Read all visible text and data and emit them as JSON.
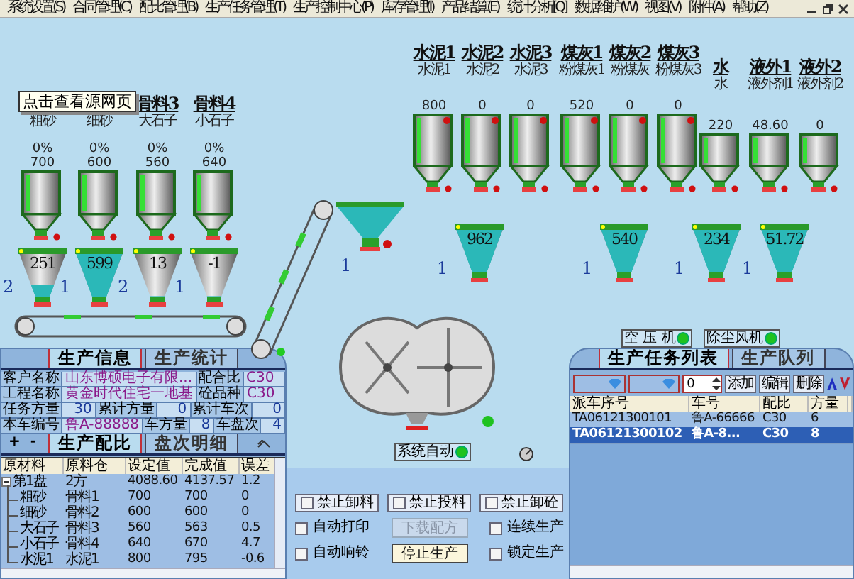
{
  "menu": [
    "系统设置(S)",
    "合同管理(C)",
    "配比管理(B)",
    "生产任务管理(T)",
    "生产控制中心(P)",
    "库存管理(I)",
    "产品结算(E)",
    "统计分析[Q]",
    "数据维护(W)",
    "视图(V)",
    "附件(A)",
    "帮助(Z)"
  ],
  "tooltip": "点击查看源网页",
  "aggregates": [
    {
      "subtitle": "粗砂",
      "percent": "0%",
      "value": "700",
      "weight": "251",
      "count": "2",
      "level": 0.25
    },
    {
      "subtitle": "细砂",
      "percent": "0%",
      "value": "600",
      "weight": "599",
      "count": "1",
      "level": 1
    },
    {
      "label": "骨料3",
      "subtitle": "大石子",
      "percent": "0%",
      "value": "560",
      "weight": "13",
      "count": "2",
      "level": 0
    },
    {
      "label": "骨料4",
      "subtitle": "小石子",
      "percent": "0%",
      "value": "640",
      "weight": "-1",
      "count": "1",
      "level": 0
    }
  ],
  "powders": [
    {
      "label": "水泥1",
      "subtitle": "水泥1",
      "value": "800"
    },
    {
      "label": "水泥2",
      "subtitle": "水泥2",
      "value": "0"
    },
    {
      "label": "水泥3",
      "subtitle": "水泥3",
      "value": "0"
    },
    {
      "label": "煤灰1",
      "subtitle": "粉煤灰1",
      "value": "520"
    },
    {
      "label": "煤灰2",
      "subtitle": "粉煤灰",
      "value": "0"
    },
    {
      "label": "煤灰3",
      "subtitle": "粉煤灰3",
      "value": "0"
    }
  ],
  "liquids": [
    {
      "label": "水",
      "subtitle": "水",
      "value": "220"
    },
    {
      "label": "液外1",
      "subtitle": "液外剂1",
      "value": "48.60"
    },
    {
      "label": "液外2",
      "subtitle": "液外剂2",
      "value": "0"
    }
  ],
  "scales": [
    {
      "value": "962",
      "count": "1",
      "level": 1
    },
    {
      "value": "540",
      "count": "1",
      "level": 1
    },
    {
      "value": "234",
      "count": "1",
      "level": 1
    },
    {
      "value": "51.72",
      "count": "1",
      "level": 1
    }
  ],
  "belt_hopper": {
    "count": "1"
  },
  "system_mode": "系统自动",
  "devices": [
    "空 压 机",
    "除尘风机"
  ],
  "info_tabs": [
    {
      "label": "生产信息",
      "selected": true
    },
    {
      "label": "生产统计",
      "selected": false
    }
  ],
  "info_rows": [
    [
      {
        "kind": "label",
        "text": "客户名称"
      },
      {
        "kind": "text",
        "text": "山东博硕电子有限..."
      },
      {
        "kind": "label",
        "text": "配合比"
      },
      {
        "kind": "text",
        "text": "C30"
      }
    ],
    [
      {
        "kind": "label",
        "text": "工程名称"
      },
      {
        "kind": "text",
        "text": "黄金时代住宅一地基"
      },
      {
        "kind": "label",
        "text": "砼品种"
      },
      {
        "kind": "text",
        "text": "C30"
      }
    ],
    [
      {
        "kind": "label",
        "text": "任务方量"
      },
      {
        "kind": "number",
        "text": "30"
      },
      {
        "kind": "label",
        "text": "累计方量"
      },
      {
        "kind": "number",
        "text": "0"
      },
      {
        "kind": "label",
        "text": "累计车次"
      },
      {
        "kind": "number",
        "text": "0"
      }
    ],
    [
      {
        "kind": "label",
        "text": "本车编号"
      },
      {
        "kind": "text",
        "text": "鲁A-88888"
      },
      {
        "kind": "label",
        "text": "车方量"
      },
      {
        "kind": "number",
        "text": "8"
      },
      {
        "kind": "label",
        "text": "车盘次"
      },
      {
        "kind": "number",
        "text": "4"
      }
    ]
  ],
  "tree_buttons": [
    "+",
    "-"
  ],
  "recipe_tabs": [
    {
      "label": "生产配比",
      "selected": true
    },
    {
      "label": "盘次明细",
      "selected": false
    }
  ],
  "recipe_columns": [
    "原材料",
    "原料仓",
    "设定值",
    "完成值",
    "误差"
  ],
  "recipe_rows": [
    {
      "cells": [
        "第1盘",
        "2方",
        "4088.60",
        "4137.57",
        "1.2"
      ],
      "expanded": true,
      "children": [
        {
          "cells": [
            "粗砂",
            "骨料1",
            "700",
            "700",
            "0"
          ]
        },
        {
          "cells": [
            "细砂",
            "骨料2",
            "600",
            "600",
            "0"
          ]
        },
        {
          "cells": [
            "大石子",
            "骨料3",
            "560",
            "563",
            "0.5"
          ]
        },
        {
          "cells": [
            "小石子",
            "骨料4",
            "640",
            "670",
            "4.7"
          ]
        },
        {
          "cells": [
            "水泥1",
            "水泥1",
            "800",
            "795",
            "-0.6"
          ]
        }
      ]
    }
  ],
  "inhibit_buttons": [
    {
      "label": "禁止卸料",
      "checked": false
    },
    {
      "label": "禁止投料",
      "checked": false
    },
    {
      "label": "禁止卸砼",
      "checked": false
    }
  ],
  "options": [
    {
      "label": "自动打印",
      "checked": false
    },
    {
      "label": "自动响铃",
      "checked": false
    },
    {
      "label": "连续生产",
      "checked": false
    },
    {
      "label": "锁定生产",
      "checked": false
    }
  ],
  "download_button": {
    "label": "下载配方",
    "disabled": true
  },
  "stop_button": {
    "label": "停止生产"
  },
  "queue_tabs": [
    {
      "label": "生产任务列表",
      "selected": true
    },
    {
      "label": "生产队列",
      "selected": false
    }
  ],
  "spinner_value": "0",
  "queue_buttons": [
    "添加",
    "编辑",
    "删除"
  ],
  "queue_columns": [
    "派车序号",
    "车号",
    "配比",
    "方量"
  ],
  "queue_rows": [
    {
      "cells": [
        "TA06121300101",
        "鲁A-66666",
        "C30",
        "6"
      ],
      "selected": false
    },
    {
      "cells": [
        "TA06121300102",
        "鲁A-8...",
        "C30",
        "8"
      ],
      "selected": true
    }
  ]
}
